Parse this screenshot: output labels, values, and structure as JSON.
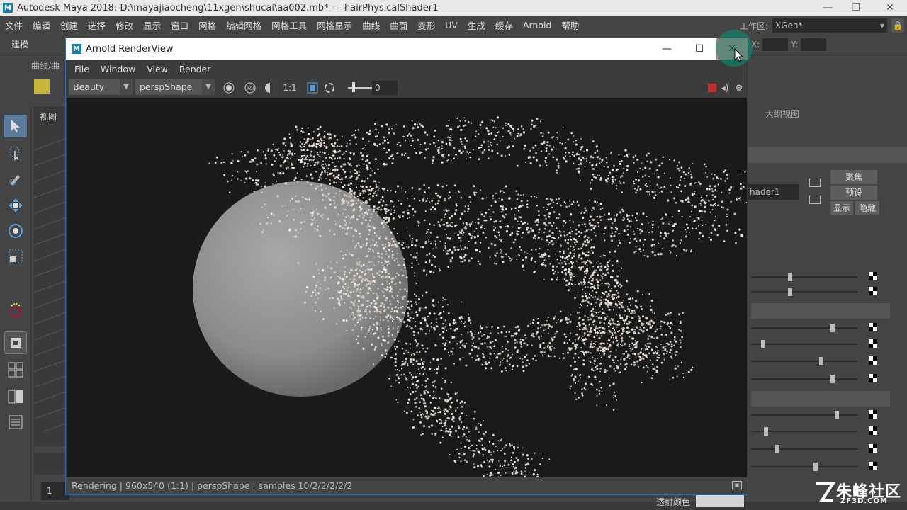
{
  "maya": {
    "title": "Autodesk Maya 2018: D:\\mayajiaocheng\\11xgen\\shucai\\aa002.mb*   ---   hairPhysicalShader1",
    "menu": [
      "文件",
      "编辑",
      "创建",
      "选择",
      "修改",
      "显示",
      "窗口",
      "网格",
      "编辑网格",
      "网格工具",
      "网格显示",
      "曲线",
      "曲面",
      "变形",
      "UV",
      "生成",
      "缓存",
      "Arnold",
      "帮助"
    ],
    "workspace_label": "工作区:",
    "workspace_value": "XGen*",
    "mode": "建模",
    "shelf_tab": "曲线/曲",
    "x_label": "X:",
    "y_label": "Y:",
    "viewport_label": "视图",
    "outliner_tab": "大纲视图",
    "shader_name": "hader1",
    "buttons": {
      "focus": "聚焦",
      "preset": "预设",
      "show": "显示",
      "hide": "隐藏"
    },
    "frame": "1",
    "transmission_label": "透射颜色"
  },
  "renderview": {
    "title": "Arnold RenderView",
    "menu": [
      "File",
      "Window",
      "View",
      "Render"
    ],
    "aov": "Beauty",
    "camera": "perspShape",
    "ratio_label": "1:1",
    "exposure": "0",
    "status": "Rendering | 960x540 (1:1) | perspShape  | samples 10/2/2/2/2/2"
  },
  "watermark": {
    "main": "朱峰社区",
    "sub": "ZF3D.COM"
  },
  "colors": {
    "maya_bg": "#444444",
    "render_bg": "#1a1a1a",
    "selection_blue": "#5b7b9c",
    "close_hover": "#d7787e",
    "stop_red": "#c0302f"
  }
}
